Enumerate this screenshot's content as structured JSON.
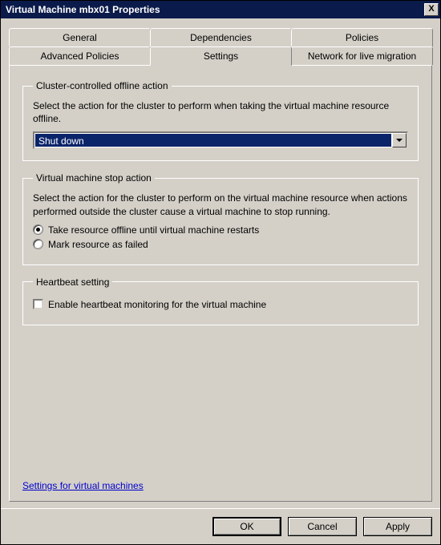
{
  "window": {
    "title": "Virtual Machine mbx01 Properties",
    "close_glyph": "X"
  },
  "tabs": {
    "row1": [
      {
        "label": "General"
      },
      {
        "label": "Dependencies"
      },
      {
        "label": "Policies"
      }
    ],
    "row2": [
      {
        "label": "Advanced Policies"
      },
      {
        "label": "Settings"
      },
      {
        "label": "Network for live migration"
      }
    ]
  },
  "groups": {
    "offline_action": {
      "legend": "Cluster-controlled offline action",
      "desc": "Select the action for the cluster to perform when taking the virtual machine resource offline.",
      "dropdown_value": "Shut down"
    },
    "stop_action": {
      "legend": "Virtual machine stop action",
      "desc": "Select the action for the cluster to perform on the virtual machine resource when actions performed outside the cluster cause a virtual machine to stop running.",
      "radio1": "Take resource offline until virtual machine restarts",
      "radio2": "Mark resource as failed"
    },
    "heartbeat": {
      "legend": "Heartbeat setting",
      "check_label": "Enable heartbeat monitoring for the virtual machine"
    }
  },
  "link": {
    "label": "Settings for virtual machines"
  },
  "buttons": {
    "ok": "OK",
    "cancel": "Cancel",
    "apply": "Apply"
  }
}
